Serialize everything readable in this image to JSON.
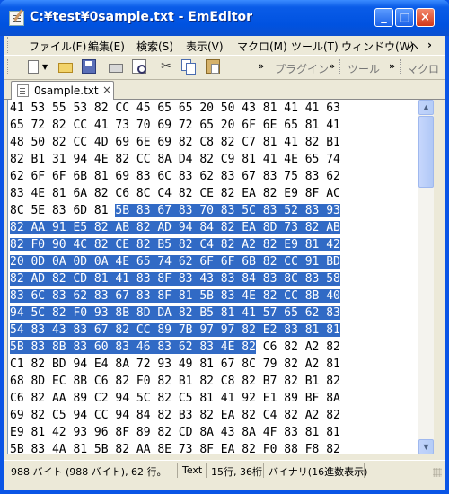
{
  "window": {
    "title": "C:¥test¥0sample.txt - EmEditor",
    "controls": {
      "minimize": "_",
      "maximize": "□",
      "close": "×"
    }
  },
  "menubar": {
    "items": [
      {
        "label": "ファイル(F)"
      },
      {
        "label": "編集(E)"
      },
      {
        "label": "検索(S)"
      },
      {
        "label": "表示(V)"
      },
      {
        "label": "マクロ(M)"
      },
      {
        "label": "ツール(T)"
      },
      {
        "label": "ウィンドウ(W)"
      },
      {
        "label": "ヘ"
      }
    ],
    "more": "›"
  },
  "toolbar": {
    "icons": [
      "new-icon",
      "open-icon",
      "save-icon",
      "print-icon",
      "print-preview-icon",
      "cut-icon",
      "copy-icon",
      "paste-icon"
    ],
    "more1": "»",
    "plugins_label": "プラグイン",
    "more2": "»",
    "tools_label": "ツール",
    "more3": "»",
    "macro_label": "マクロ"
  },
  "tab": {
    "label": "0sample.txt",
    "close": "×"
  },
  "editor": {
    "lines": [
      {
        "pre": "41 53 55 53 82 CC 45 65 65 20 50 43 81 41 41 63",
        "sel": "",
        "post": ""
      },
      {
        "pre": "65 72 82 CC 41 73 70 69 72 65 20 6F 6E 65 81 41",
        "sel": "",
        "post": ""
      },
      {
        "pre": "48 50 82 CC 4D 69 6E 69 82 C8 82 C7 81 41 82 B1",
        "sel": "",
        "post": ""
      },
      {
        "pre": "82 B1 31 94 4E 82 CC 8A D4 82 C9 81 41 4E 65 74",
        "sel": "",
        "post": ""
      },
      {
        "pre": "62 6F 6F 6B 81 69 83 6C 83 62 83 67 83 75 83 62",
        "sel": "",
        "post": ""
      },
      {
        "pre": "83 4E 81 6A 82 C6 8C C4 82 CE 82 EA 82 E9 8F AC",
        "sel": "",
        "post": ""
      },
      {
        "pre": "8C 5E 83 6D 81 ",
        "sel": "5B 83 67 83 70 83 5C 83 52 83 93",
        "post": ""
      },
      {
        "pre": "",
        "sel": "82 AA 91 E5 82 AB 82 AD 94 84 82 EA 8D 73 82 AB",
        "post": ""
      },
      {
        "pre": "",
        "sel": "82 F0 90 4C 82 CE 82 B5 82 C4 82 A2 82 E9 81 42",
        "post": ""
      },
      {
        "pre": "",
        "sel": "20 0D 0A 0D 0A 4E 65 74 62 6F 6F 6B 82 CC 91 BD",
        "post": ""
      },
      {
        "pre": "",
        "sel": "82 AD 82 CD 81 41 83 8F 83 43 83 84 83 8C 83 58",
        "post": ""
      },
      {
        "pre": "",
        "sel": "83 6C 83 62 83 67 83 8F 81 5B 83 4E 82 CC 8B 40",
        "post": ""
      },
      {
        "pre": "",
        "sel": "94 5C 82 F0 93 8B 8D DA 82 B5 81 41 57 65 62 83",
        "post": ""
      },
      {
        "pre": "",
        "sel": "54 83 43 83 67 82 CC 89 7B 97 97 82 E2 83 81 81",
        "post": ""
      },
      {
        "pre": "",
        "sel": "5B 83 8B 83 60 83 46 83 62 83 4E 82",
        "post": " C6 82 A2 82"
      },
      {
        "pre": "C1 82 BD 94 E4 8A 72 93 49 81 67 8C 79 82 A2 81",
        "sel": "",
        "post": ""
      },
      {
        "pre": "68 8D EC 8B C6 82 F0 82 B1 82 C8 82 B7 82 B1 82",
        "sel": "",
        "post": ""
      },
      {
        "pre": "C6 82 AA 89 C2 94 5C 82 C5 81 41 92 E1 89 BF 8A",
        "sel": "",
        "post": ""
      },
      {
        "pre": "69 82 C5 94 CC 94 84 82 B3 82 EA 82 C4 82 A2 82",
        "sel": "",
        "post": ""
      },
      {
        "pre": "E9 81 42 93 96 8F 89 82 CD 8A 43 8A 4F 83 81 81",
        "sel": "",
        "post": ""
      },
      {
        "pre": "5B 83 4A 81 5B 82 AA 8E 73 8F EA 82 F0 88 F8 82",
        "sel": "",
        "post": ""
      }
    ]
  },
  "scrollbar": {
    "up": "▲",
    "down": "▼"
  },
  "statusbar": {
    "size": "988 バイト (988 バイト), 62 行。",
    "mode": "Text",
    "position": "15行, 36桁",
    "view": "バイナリ(16進数表示)"
  }
}
